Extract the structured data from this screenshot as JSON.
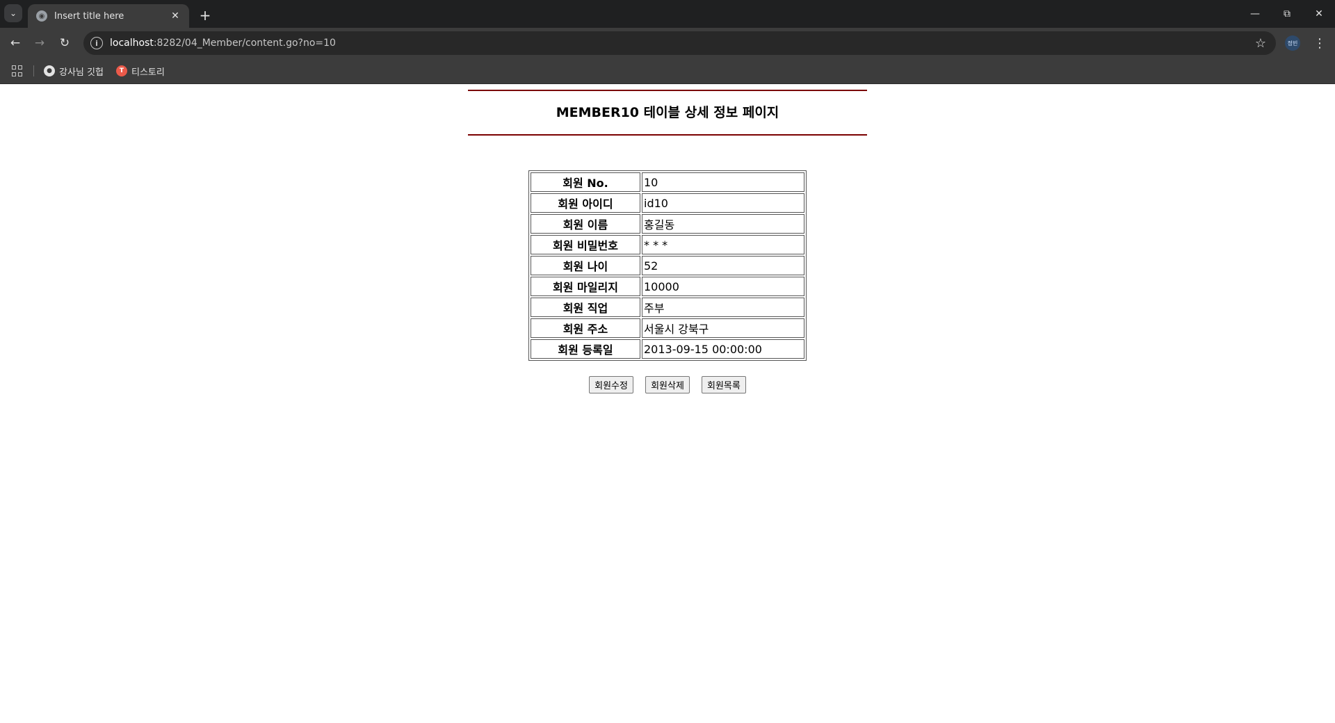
{
  "browser": {
    "tab_title": "Insert title here",
    "tab_favicon": "globe-icon",
    "url_host": "localhost",
    "url_rest": ":8282/04_Member/content.go?no=10",
    "profile_label": "정빈",
    "bookmarks": [
      {
        "label": "강사님 깃헙",
        "icon": "github-icon"
      },
      {
        "label": "티스토리",
        "icon": "tistory-icon"
      }
    ]
  },
  "page": {
    "title": "MEMBER10 테이블 상세 정보 페이지",
    "accent_color": "#7a0000",
    "rows": [
      {
        "label": "회원 No.",
        "value": "10"
      },
      {
        "label": "회원 아이디",
        "value": "id10"
      },
      {
        "label": "회원 이름",
        "value": "홍길동"
      },
      {
        "label": "회원 비밀번호",
        "value": "* * *"
      },
      {
        "label": "회원 나이",
        "value": "52"
      },
      {
        "label": "회원 마일리지",
        "value": "10000"
      },
      {
        "label": "회원 직업",
        "value": "주부"
      },
      {
        "label": "회원 주소",
        "value": "서울시 강북구"
      },
      {
        "label": "회원 등록일",
        "value": "2013-09-15 00:00:00"
      }
    ],
    "buttons": {
      "edit": "회원수정",
      "delete": "회원삭제",
      "list": "회원목록"
    }
  }
}
